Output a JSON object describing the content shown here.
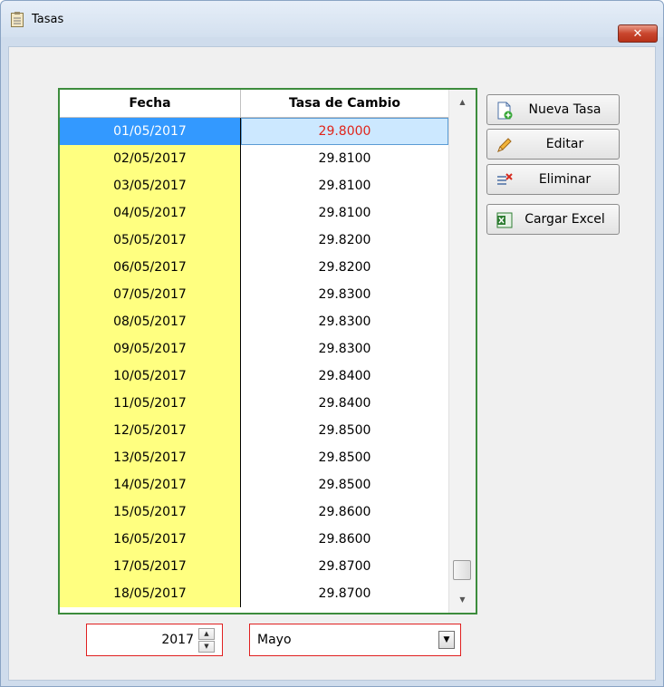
{
  "window": {
    "title": "Tasas",
    "close_label": "✕"
  },
  "grid": {
    "columns": [
      "Fecha",
      "Tasa de Cambio"
    ],
    "selected_index": 0,
    "rows": [
      [
        "01/05/2017",
        "29.8000"
      ],
      [
        "02/05/2017",
        "29.8100"
      ],
      [
        "03/05/2017",
        "29.8100"
      ],
      [
        "04/05/2017",
        "29.8100"
      ],
      [
        "05/05/2017",
        "29.8200"
      ],
      [
        "06/05/2017",
        "29.8200"
      ],
      [
        "07/05/2017",
        "29.8300"
      ],
      [
        "08/05/2017",
        "29.8300"
      ],
      [
        "09/05/2017",
        "29.8300"
      ],
      [
        "10/05/2017",
        "29.8400"
      ],
      [
        "11/05/2017",
        "29.8400"
      ],
      [
        "12/05/2017",
        "29.8500"
      ],
      [
        "13/05/2017",
        "29.8500"
      ],
      [
        "14/05/2017",
        "29.8500"
      ],
      [
        "15/05/2017",
        "29.8600"
      ],
      [
        "16/05/2017",
        "29.8600"
      ],
      [
        "17/05/2017",
        "29.8700"
      ],
      [
        "18/05/2017",
        "29.8700"
      ]
    ]
  },
  "actions": {
    "new": "Nueva Tasa",
    "edit": "Editar",
    "delete": "Eliminar",
    "excel": "Cargar Excel"
  },
  "filters": {
    "year": "2017",
    "month": "Mayo"
  },
  "colors": {
    "date_column_bg": "#ffff80",
    "selected_row_bg": "#3399ff",
    "selected_value_text": "#e0241b",
    "grid_border": "#3d8c3d",
    "filter_border": "#e02020"
  },
  "icons": {
    "window": "clipboard-icon",
    "new": "new-document-icon",
    "edit": "pencil-icon",
    "delete": "delete-rows-icon",
    "excel": "excel-icon"
  }
}
